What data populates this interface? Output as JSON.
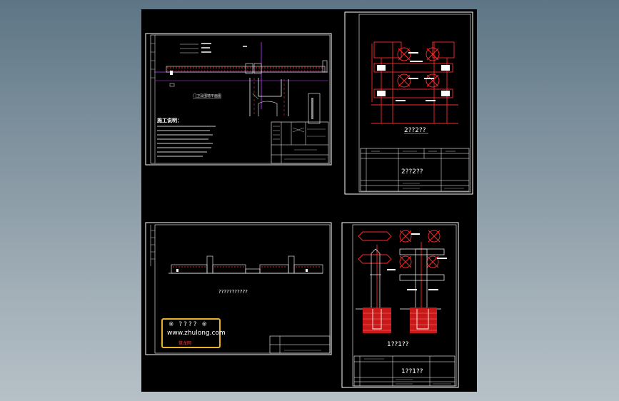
{
  "colors": {
    "background": "#7d909c",
    "sheet": "#000000",
    "frame": "#ffffff",
    "cad_red": "#ff2a2a",
    "cad_magenta": "#c040ff",
    "cad_green": "#30d070",
    "watermark_border": "#e8b22a"
  },
  "sheets": {
    "top_left": {
      "plan_title": "门卫及围墙平面图",
      "notes_heading": "施工说明："
    },
    "top_right": {
      "section_caption": "2??2??",
      "titleblock_caption": "2??2??"
    },
    "bottom_left": {
      "elevation_caption": "???????????"
    },
    "bottom_right": {
      "section_caption": "1??1??",
      "titleblock_caption": "1??1??"
    }
  },
  "watermark": {
    "line1": "※ ???? ※",
    "line2": "www.zhulong.com",
    "line3": "筑龙网"
  }
}
